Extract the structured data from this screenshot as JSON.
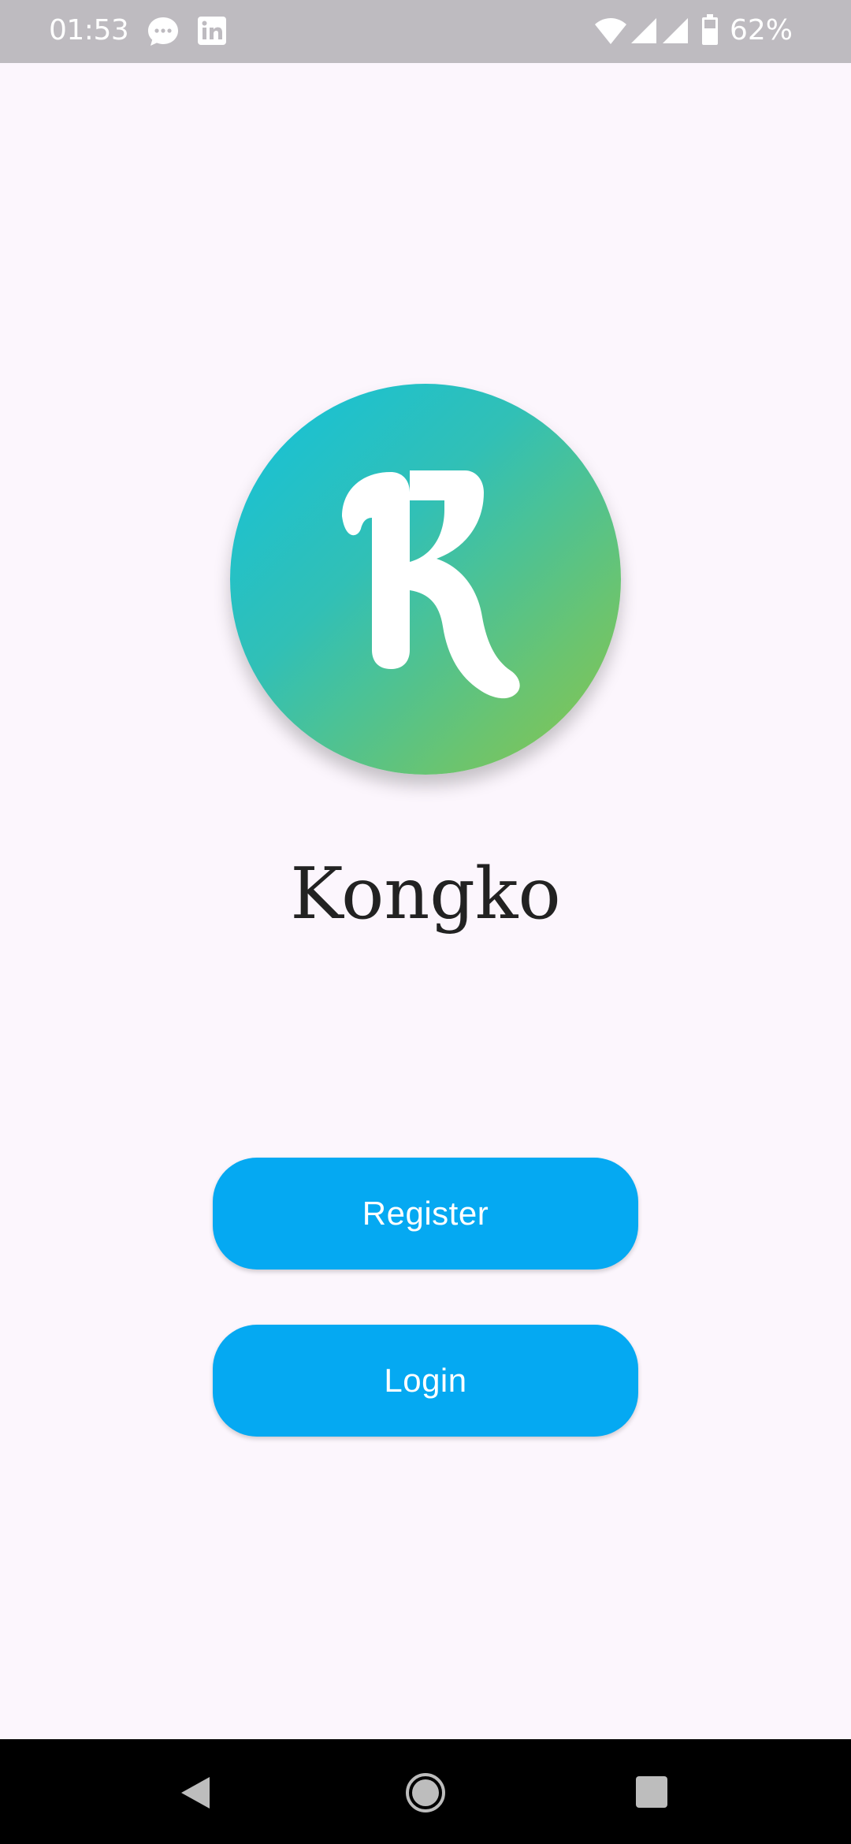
{
  "status_bar": {
    "time": "01:53",
    "battery": "62%",
    "icons": [
      "chat-notification-icon",
      "linkedin-icon",
      "wifi-icon",
      "signal-icon",
      "signal-icon",
      "battery-icon"
    ]
  },
  "app": {
    "name": "Kongko",
    "logo_letter": "K",
    "logo_colors": [
      "#13c2dc",
      "#8bc64a"
    ]
  },
  "buttons": {
    "register": "Register",
    "login": "Login"
  },
  "colors": {
    "background": "#fcf6fd",
    "button": "#05a9f2",
    "status_bar": "#bebbc0"
  },
  "nav_bar": {
    "icons": [
      "back-icon",
      "home-icon",
      "recents-icon"
    ]
  }
}
